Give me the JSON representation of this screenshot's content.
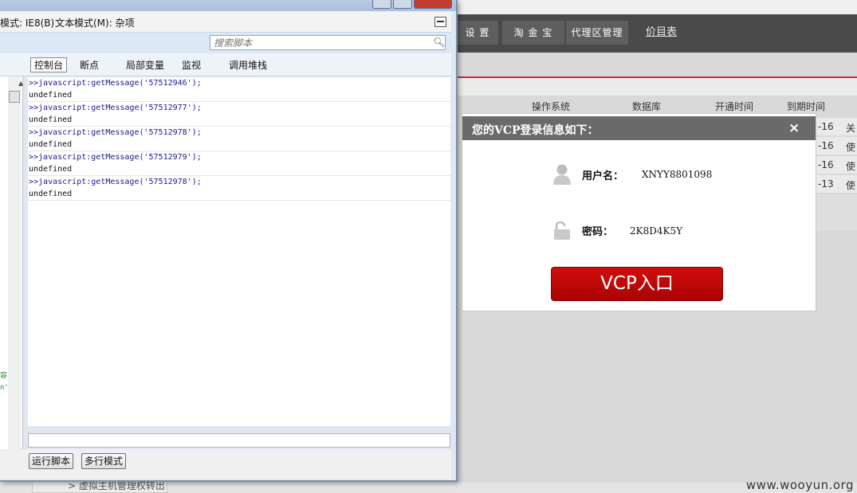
{
  "background_page": {
    "nav": [
      {
        "label": "设 置"
      },
      {
        "label": "淘 金 宝"
      },
      {
        "label": "代理区管理"
      }
    ],
    "nav_link": "价目表",
    "table_headers": [
      "操作系统",
      "数据库",
      "开通时间",
      "到期时间"
    ],
    "rows": [
      {
        "date": "-16",
        "status": "关"
      },
      {
        "date": "-16",
        "status": "使"
      },
      {
        "date": "-16",
        "status": "使"
      },
      {
        "date": "-13",
        "status": "使"
      }
    ],
    "bottom_tab": "> 虚拟主机管理权转出",
    "watermark": "www.wooyun.org"
  },
  "devtools": {
    "menu": {
      "doc_mode": "模式: IE8(B)",
      "text_mode": "文本模式(M): 杂项"
    },
    "search_placeholder": "搜索脚本",
    "tabs": [
      "控制台",
      "断点",
      "局部变量",
      "监视",
      "调用堆栈"
    ],
    "active_tab": "控制台",
    "left_fragments": [
      "容",
      "n'"
    ],
    "console_entries": [
      {
        "cmd": ">>javascript:getMessage('57512946');",
        "result": "undefined"
      },
      {
        "cmd": ">>javascript:getMessage('57512977');",
        "result": "undefined"
      },
      {
        "cmd": ">>javascript:getMessage('57512978');",
        "result": "undefined"
      },
      {
        "cmd": ">>javascript:getMessage('57512979');",
        "result": "undefined"
      },
      {
        "cmd": ">>javascript:getMessage('57512978');",
        "result": "undefined"
      }
    ],
    "run_button": "运行脚本",
    "multiline_button": "多行模式"
  },
  "modal": {
    "title": "您的VCP登录信息如下：",
    "close": "×",
    "username_label": "用户名：",
    "username_value": "XNYY8801098",
    "password_label": "密码：",
    "password_value": "2K8D4K5Y",
    "button": "VCP入口"
  },
  "colors": {
    "accent_red": "#c62a2a",
    "modal_header": "#6a6a6a",
    "nav_bg": "#4a4a4a"
  }
}
